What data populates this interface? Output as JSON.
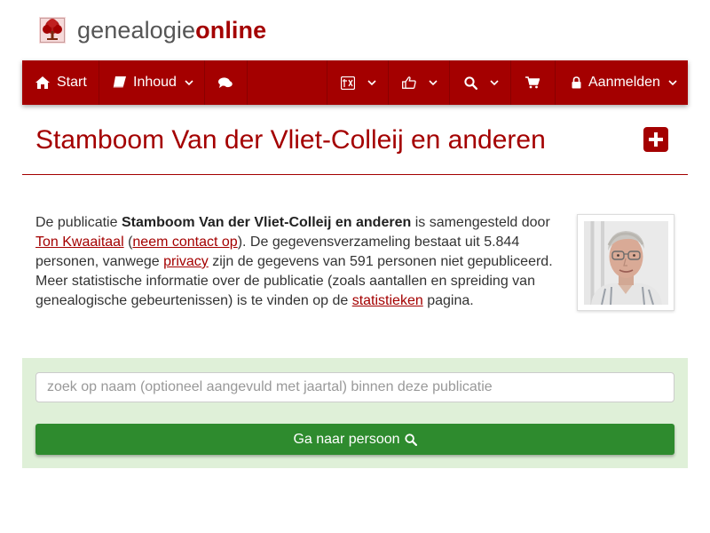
{
  "brand": {
    "part1": "genealogie",
    "part2": "online",
    "logo_icon": "tree-logo-icon"
  },
  "colors": {
    "accent": "#a40000",
    "panel": "#dff0d8",
    "button": "#2e8b2e"
  },
  "navbar": {
    "start_label": "Start",
    "inhoud_label": "Inhoud",
    "login_label": "Aanmelden",
    "icons": [
      "home-icon",
      "book-icon",
      "comments-icon",
      "language-icon",
      "thumbs-up-icon",
      "search-icon",
      "cart-icon",
      "lock-icon"
    ]
  },
  "page": {
    "title": "Stamboom Van der Vliet-Colleij en anderen"
  },
  "intro": {
    "t1": "De publicatie ",
    "pub_name": "Stamboom Van der Vliet-Colleij en anderen",
    "t2": " is samengesteld door ",
    "author_link": "Ton Kwaaitaal",
    "t3": " (",
    "contact_link": "neem contact op",
    "t4": "). De gegevensverzameling bestaat uit 5.844 personen, vanwege ",
    "privacy_link": "privacy",
    "t5": " zijn de gegevens van 591 personen niet gepubliceerd. Meer statistische informatie over de publicatie (zoals aantallen en spreiding van genealogische gebeurtenissen) is te vinden op de ",
    "stats_link": "statistieken",
    "t6": " pagina."
  },
  "search": {
    "placeholder": "zoek op naam (optioneel aangevuld met jaartal) binnen deze publicatie",
    "value": "",
    "button_label": "Ga naar persoon"
  }
}
